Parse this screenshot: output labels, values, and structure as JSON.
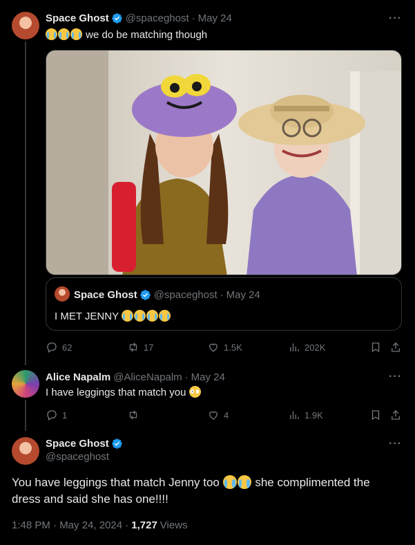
{
  "tweet1": {
    "name": "Space Ghost",
    "handle": "@spaceghost",
    "dot": "·",
    "date": "May 24",
    "text": "we do be matching though",
    "stats": {
      "replies": "62",
      "retweets": "17",
      "likes": "1.5K",
      "views": "202K"
    }
  },
  "quote": {
    "name": "Space Ghost",
    "handle": "@spaceghost",
    "dot": "·",
    "date": "May 24",
    "text": "I MET JENNY"
  },
  "tweet2": {
    "name": "Alice Napalm",
    "handle": "@AliceNapalm",
    "dot": "·",
    "date": "May 24",
    "text": "I have leggings that match you",
    "stats": {
      "replies": "1",
      "retweets": "",
      "likes": "4",
      "views": "1.9K"
    }
  },
  "tweet3": {
    "name": "Space Ghost",
    "handle": "@spaceghost",
    "text_part1": "You have leggings that match Jenny too",
    "text_part2": "she complimented the dress and said she has one!!!!",
    "time": "1:48 PM · May 24, 2024 ·",
    "views_count": "1,727",
    "views_label": "Views"
  },
  "icons": {
    "verified": "verified-badge-icon",
    "more": "more-icon",
    "reply": "reply-icon",
    "retweet": "retweet-icon",
    "like": "like-icon",
    "views": "views-icon",
    "bookmark": "bookmark-icon",
    "share": "share-icon"
  },
  "colors": {
    "background": "#000000",
    "verified": "#1d9bf0",
    "muted": "#71767b",
    "text": "#e7e9ea",
    "border": "#333639"
  }
}
